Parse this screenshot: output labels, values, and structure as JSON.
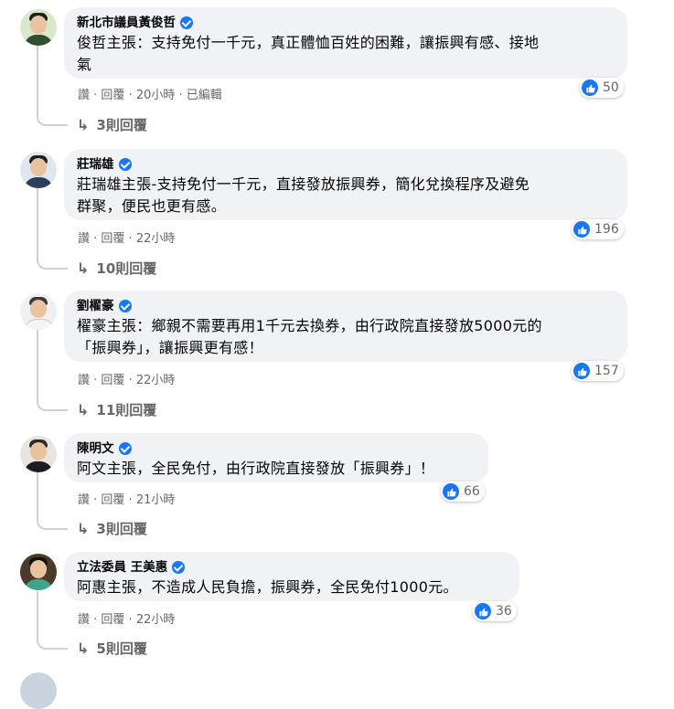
{
  "like_color": "#1877f2",
  "comments": [
    {
      "author": "新北市議員黃俊哲",
      "text_line1": "俊哲主張：支持免付一千元，真正體恤百姓的困難，讓振興有感、接地",
      "text_line2": "氣",
      "likes": "50",
      "like_action": "讚",
      "reply_action": "回覆",
      "time": "20小時",
      "edited": "已編輯",
      "replies": "3則回覆"
    },
    {
      "author": "莊瑞雄",
      "text_line1": "莊瑞雄主張-支持免付一千元，直接發放振興券，簡化兌換程序及避免",
      "text_line2": "群聚，便民也更有感。",
      "likes": "196",
      "like_action": "讚",
      "reply_action": "回覆",
      "time": "22小時",
      "replies": "10則回覆"
    },
    {
      "author": "劉櫂豪",
      "text_line1": "櫂豪主張：鄉親不需要再用1千元去換券，由行政院直接發放5000元的",
      "text_line2": "「振興券」，讓振興更有感！",
      "likes": "157",
      "like_action": "讚",
      "reply_action": "回覆",
      "time": "22小時",
      "replies": "11則回覆"
    },
    {
      "author": "陳明文",
      "text_line1": "阿文主張，全民免付，由行政院直接發放「振興券」！",
      "likes": "66",
      "like_action": "讚",
      "reply_action": "回覆",
      "time": "21小時",
      "replies": "3則回覆"
    },
    {
      "author": "立法委員 王美惠",
      "text_line1": "阿惠主張，不造成人民負擔，振興券，全民免付1000元。",
      "likes": "36",
      "like_action": "讚",
      "reply_action": "回覆",
      "time": "22小時",
      "replies": "5則回覆"
    }
  ]
}
